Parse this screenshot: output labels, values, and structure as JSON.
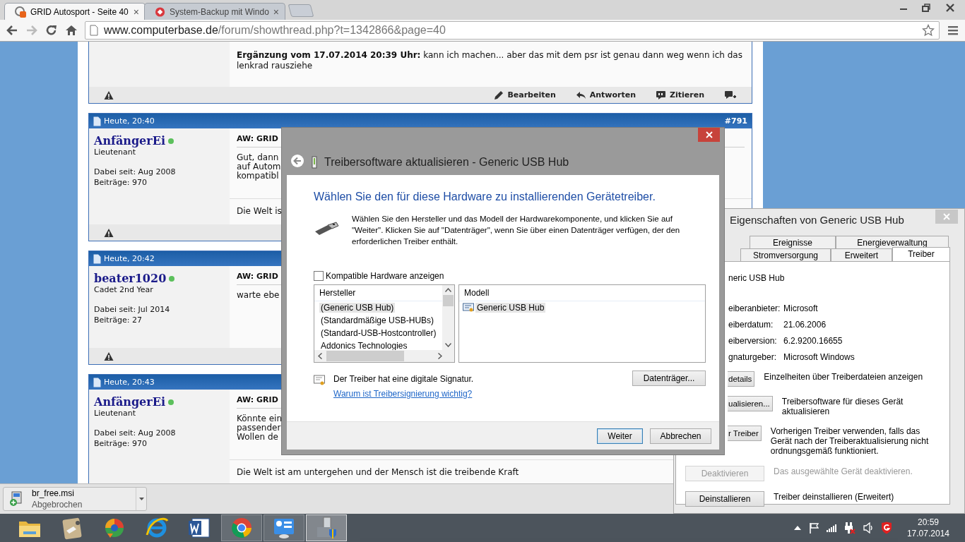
{
  "browser": {
    "tabs": [
      {
        "title": "GRID Autosport - Seite 40",
        "close": "×",
        "selected": true
      },
      {
        "title": "System-Backup mit Windo",
        "close": "×",
        "selected": false
      }
    ],
    "toolbar": {
      "forward_disabled": true,
      "url_host": "www.computerbase.de",
      "url_path": "/forum/showthread.php?t=1342866&page=40"
    }
  },
  "forum": {
    "partial_post": {
      "text": "**Ergänzung vom 17.07.2014 20:39 Uhr:** kann ich machen... aber das mit dem psr ist genau dann weg wenn ich das lenkrad rausziehe",
      "actions": [
        {
          "kind": "edit",
          "label": "Bearbeiten"
        },
        {
          "kind": "reply",
          "label": "Antworten"
        },
        {
          "kind": "quote",
          "label": "Zitieren"
        },
        {
          "kind": "multiquote"
        }
      ]
    },
    "posts": [
      {
        "date": "Heute, 20:40",
        "number": "#791",
        "author": "AnfängerEi",
        "online": true,
        "rank": "Lieutenant",
        "joined": "Dabei seit: Aug 2008",
        "count": "Beiträge: 970",
        "title": "AW: GRID",
        "lines": [
          "Gut, dann",
          "auf Autom",
          "kompatibl"
        ],
        "signature": "Die Welt is"
      },
      {
        "date": "Heute, 20:42",
        "author": "beater1020",
        "online": true,
        "rank": "Cadet 2nd Year",
        "joined": "Dabei seit: Jul 2014",
        "count": "Beiträge: 27",
        "title": "AW: GRID",
        "lines": [
          "warte ebe"
        ]
      },
      {
        "date": "Heute, 20:43",
        "author": "AnfängerEi",
        "online": true,
        "rank": "Lieutenant",
        "joined": "Dabei seit: Aug 2008",
        "count": "Beiträge: 970",
        "title": "AW: GRID",
        "lines": [
          "Könnte ein",
          "passender",
          "Wollen de"
        ],
        "signature": "Die Welt ist am untergehen und der Mensch ist die treibende Kraft"
      }
    ]
  },
  "download": {
    "file": "br_free.msi",
    "status": "Abgebrochen"
  },
  "dialog": {
    "title": "Treibersoftware aktualisieren - Generic USB Hub",
    "heading": "Wählen Sie den für diese Hardware zu installierenden Gerätetreiber.",
    "description": "Wählen Sie den Hersteller und das Modell der Hardwarekomponente, und klicken Sie auf \"Weiter\". Klicken Sie auf \"Datenträger\", wenn Sie über einen Datenträger verfügen, der den erforderlichen Treiber enthält.",
    "compatible": {
      "label": "Kompatible Hardware anzeigen",
      "checked": false
    },
    "manufacturers": {
      "header": "Hersteller",
      "items": [
        {
          "label": "(Generic USB Hub)",
          "selected": true
        },
        {
          "label": "(Standardmäßige USB-HUBs)",
          "selected": false
        },
        {
          "label": "(Standard-USB-Hostcontroller)",
          "selected": false
        },
        {
          "label": "Addonics Technologies",
          "selected": false
        }
      ]
    },
    "models": {
      "header": "Modell",
      "items": [
        {
          "label": "Generic USB Hub",
          "selected": true
        }
      ]
    },
    "signature_note": "Der Treiber hat eine digitale Signatur.",
    "signature_link": "Warum ist Treibersignierung wichtig?",
    "disk_button": "Datenträger...",
    "buttons": [
      {
        "label": "Weiter",
        "default": true
      },
      {
        "label": "Abbrechen",
        "default": false
      }
    ]
  },
  "properties": {
    "title": "Eigenschaften von Generic USB Hub",
    "tab_rows": [
      [
        {
          "label": "Ereignisse",
          "selected": false
        },
        {
          "label": "Energieverwaltung",
          "selected": false
        }
      ],
      [
        {
          "label": "Stromversorgung",
          "selected": false
        },
        {
          "label": "Erweitert",
          "selected": false
        },
        {
          "label": "Treiber",
          "selected": true
        }
      ]
    ],
    "device": "neric USB Hub",
    "info": [
      {
        "label": "eiberanbieter:",
        "value": "Microsoft"
      },
      {
        "label": "eiberdatum:",
        "value": "21.06.2006"
      },
      {
        "label": "eiberversion:",
        "value": "6.2.9200.16655"
      },
      {
        "label": "gnaturgeber:",
        "value": "Microsoft Windows"
      }
    ],
    "actions": [
      {
        "kind": "cut",
        "button": "details",
        "description": "Einzelheiten über Treiberdateien anzeigen",
        "disabled": false
      },
      {
        "kind": "cut",
        "button": "ualisieren...",
        "description": "Treibersoftware für dieses Gerät aktualisieren",
        "disabled": false
      },
      {
        "kind": "cut",
        "button": "r Treiber",
        "description": "Vorherigen Treiber verwenden, falls das Gerät nach der Treiberaktualisierung nicht ordnungsgemäß funktioniert.",
        "disabled": false
      },
      {
        "kind": "full",
        "button": "Deaktivieren",
        "description": "Das ausgewählte Gerät deaktivieren.",
        "disabled": true
      },
      {
        "kind": "full",
        "button": "Deinstallieren",
        "description": "Treiber deinstallieren (Erweitert)",
        "disabled": false
      }
    ]
  },
  "taskbar": {
    "apps": [
      {
        "kind": "folder",
        "running": false,
        "selected": false
      },
      {
        "kind": "tool",
        "running": false,
        "selected": false
      },
      {
        "kind": "media",
        "running": false,
        "selected": false
      },
      {
        "kind": "ie",
        "running": false,
        "selected": false
      },
      {
        "kind": "word",
        "running": false,
        "selected": false
      },
      {
        "kind": "chrome",
        "running": true,
        "selected": false
      },
      {
        "kind": "control",
        "running": true,
        "selected": false
      },
      {
        "kind": "devmgr",
        "running": true,
        "selected": true
      }
    ],
    "time": "20:59",
    "date": "17.07.2014"
  }
}
